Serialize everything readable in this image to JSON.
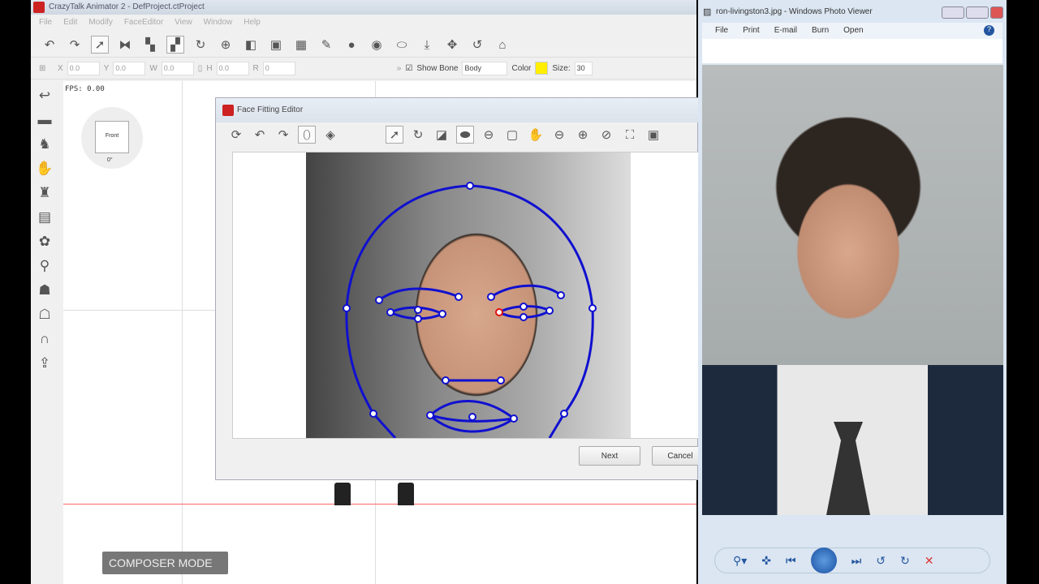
{
  "app": {
    "title": "CrazyTalk Animator 2 - DefProject.ctProject",
    "menu": [
      "File",
      "Edit",
      "Modify",
      "FaceEditor",
      "View",
      "Window",
      "Help"
    ],
    "xform": {
      "x_label": "X",
      "x": "0.0",
      "y_label": "Y",
      "y": "0.0",
      "w_label": "W",
      "w": "0.0",
      "h_label": "H",
      "h": "0.0",
      "r_label": "R",
      "r": "0"
    },
    "show_bone_label": "Show Bone",
    "show_bone_checked": true,
    "bone_select": "Body",
    "color_label": "Color",
    "color_value": "#ffee00",
    "size_label": "Size:",
    "size": "30"
  },
  "canvas": {
    "fps": "FPS: 0.00",
    "view_label": "Front",
    "angle": "0°",
    "mode_badge": "COMPOSER MODE"
  },
  "dialog": {
    "title": "Face Fitting Editor",
    "next": "Next",
    "cancel": "Cancel"
  },
  "viewer": {
    "title": "ron-livingston3.jpg - Windows Photo Viewer",
    "menu": [
      "File",
      "Print",
      "E-mail",
      "Burn",
      "Open"
    ],
    "help": "?"
  }
}
